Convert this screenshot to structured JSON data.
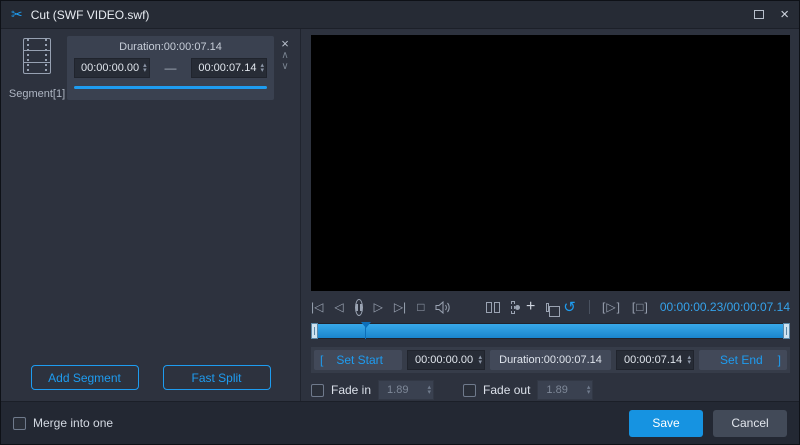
{
  "titlebar": {
    "title": "Cut (SWF VIDEO.swf)"
  },
  "segment_panel": {
    "segment_label": "Segment[1]",
    "card": {
      "duration": "Duration:00:00:07.14",
      "start": "00:00:00.00",
      "dash": "—",
      "end": "00:00:07.14"
    },
    "add_segment": "Add Segment",
    "fast_split": "Fast Split"
  },
  "player": {
    "current_time": "00:00:00.23",
    "separator": "/",
    "total_time": "00:00:07.14"
  },
  "trim": {
    "left_bracket": "[",
    "set_start": "Set Start",
    "start_value": "00:00:00.00",
    "duration": "Duration:00:00:07.14",
    "end_value": "00:00:07.14",
    "set_end": "Set End",
    "right_bracket": "]"
  },
  "fade": {
    "fade_in_label": "Fade in",
    "fade_in_value": "1.89",
    "fade_out_label": "Fade out",
    "fade_out_value": "1.89"
  },
  "footer": {
    "merge_label": "Merge into one",
    "save": "Save",
    "cancel": "Cancel"
  },
  "icons": {
    "scissors": "✂",
    "close_window": "×",
    "segment_close": "×",
    "chevron_up": "∧",
    "chevron_down": "∨",
    "spin_up": "▴",
    "spin_down": "▾",
    "prev_segment": "|◁",
    "prev_frame": "◁",
    "next_frame": "▷",
    "next_segment": "▷|",
    "stop": "□",
    "plus": "+",
    "reset": "↺",
    "clip_play": "[▷]",
    "clip_stop": "[□]"
  },
  "colors": {
    "accent": "#1e9cf0"
  }
}
